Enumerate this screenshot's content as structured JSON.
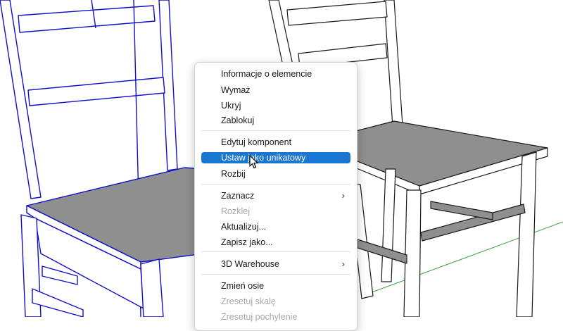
{
  "context_menu": {
    "items": [
      {
        "label": "Informacje o elemencie"
      },
      {
        "label": "Wymaż"
      },
      {
        "label": "Ukryj"
      },
      {
        "label": "Zablokuj"
      },
      {
        "label": "Edytuj komponent"
      },
      {
        "label": "Ustaw jako unikatowy",
        "highlighted": true
      },
      {
        "label": "Rozbij"
      },
      {
        "label": "Zaznacz",
        "submenu": true
      },
      {
        "label": "Rozklej",
        "disabled": true
      },
      {
        "label": "Aktualizuj..."
      },
      {
        "label": "Zapisz jako..."
      },
      {
        "label": "3D Warehouse",
        "submenu": true
      },
      {
        "label": "Zmień osie"
      },
      {
        "label": "Zresetuj skalę",
        "disabled": true
      },
      {
        "label": "Zresetuj pochylenie",
        "disabled": true
      }
    ],
    "submenu_icon": "chevron-right-icon"
  },
  "colors": {
    "highlight": "#1976d2",
    "selection_edges": "#1010c8",
    "seat_fill": "#8f8f8f",
    "green_axis": "#3aa33a",
    "disabled_text": "#a8a8a8"
  },
  "cursor_icon": "arrow-pointer-icon"
}
